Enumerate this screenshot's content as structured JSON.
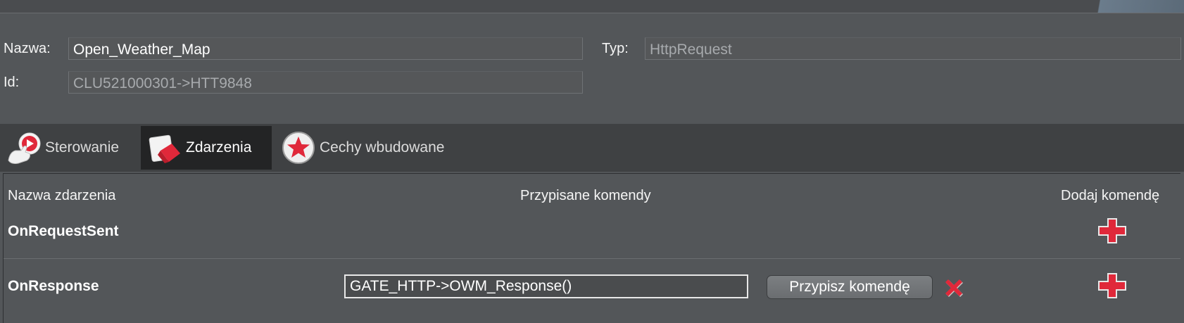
{
  "properties": {
    "name_label": "Nazwa:",
    "name_value": "Open_Weather_Map",
    "id_label": "Id:",
    "id_value": "CLU521000301->HTT9848",
    "type_label": "Typ:",
    "type_value": "HttpRequest"
  },
  "tabs": [
    {
      "label": "Sterowanie",
      "icon": "hand-play-icon",
      "selected": false
    },
    {
      "label": "Zdarzenia",
      "icon": "eraser-icon",
      "selected": true
    },
    {
      "label": "Cechy wbudowane",
      "icon": "star-badge-icon",
      "selected": false
    }
  ],
  "events_table": {
    "headers": {
      "event_name": "Nazwa zdarzenia",
      "assigned_commands": "Przypisane komendy",
      "add_command": "Dodaj komendę"
    },
    "rows": [
      {
        "name": "OnRequestSent",
        "command": ""
      },
      {
        "name": "OnResponse",
        "command": "GATE_HTTP->OWM_Response()"
      }
    ],
    "assign_button_label": "Przypisz komendę"
  },
  "colors": {
    "background": "#535659",
    "tabbar": "#3f4143",
    "selected_tab": "#232425",
    "accent_red": "#e0283a"
  }
}
